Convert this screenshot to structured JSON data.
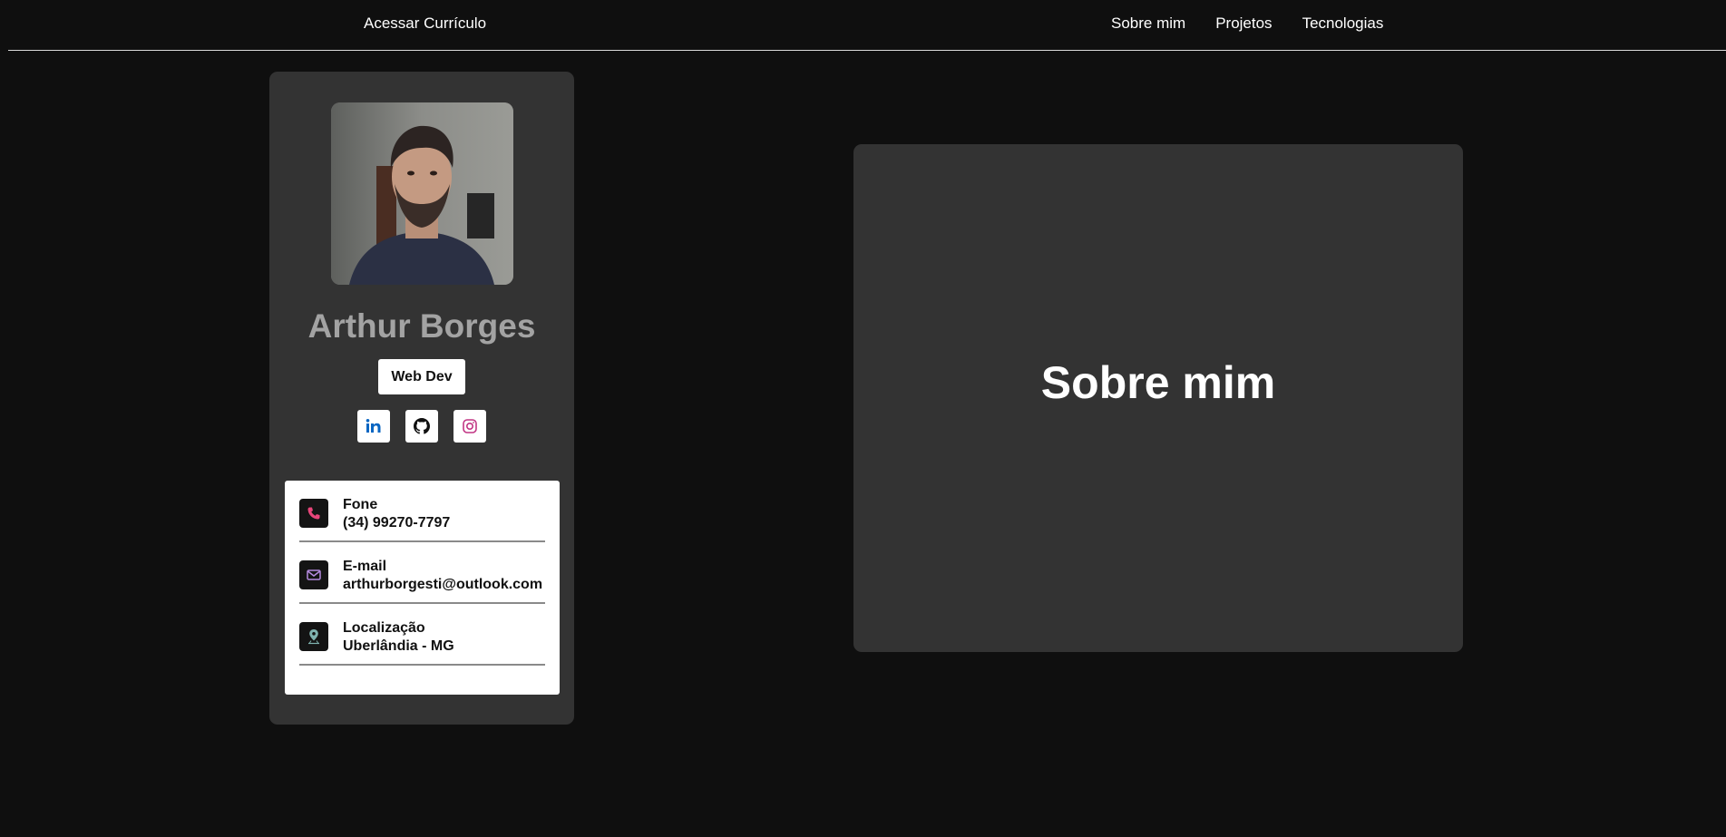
{
  "header": {
    "resume_link": "Acessar Currículo",
    "nav": [
      "Sobre mim",
      "Projetos",
      "Tecnologias"
    ]
  },
  "profile": {
    "name": "Arthur Borges",
    "role": "Web Dev",
    "socials": [
      "linkedin-icon",
      "github-icon",
      "instagram-icon"
    ],
    "contacts": [
      {
        "label": "Fone",
        "value": "(34) 99270-7797",
        "icon": "phone-icon"
      },
      {
        "label": "E-mail",
        "value": "arthurborgesti@outlook.com",
        "icon": "mail-icon"
      },
      {
        "label": "Localização",
        "value": "Uberlândia - MG",
        "icon": "location-pin-icon"
      }
    ]
  },
  "about": {
    "title": "Sobre mim"
  },
  "colors": {
    "background": "#0f0f0f",
    "card": "#333333",
    "name_text": "#a3a3a3",
    "phone_accent": "#e8457a",
    "mail_accent": "#b48adf",
    "location_accent": "#7fb3b0",
    "linkedin": "#0a66c2",
    "instagram": "#c13584"
  }
}
